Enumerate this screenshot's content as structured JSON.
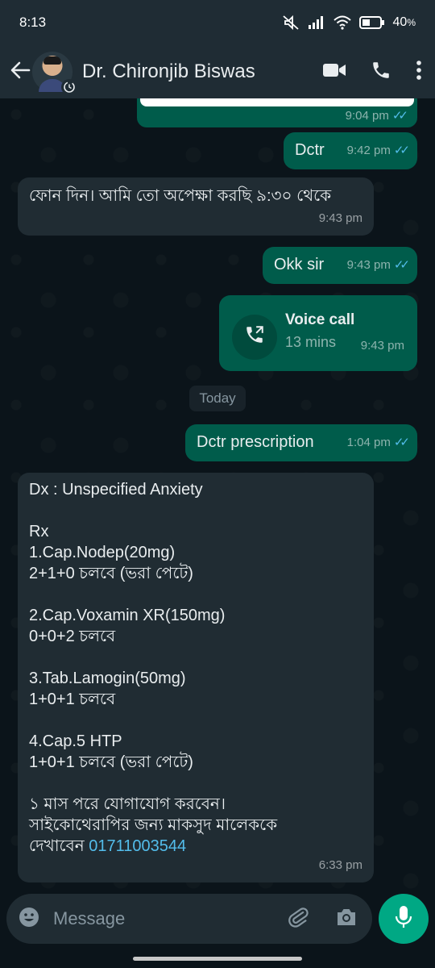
{
  "status_bar": {
    "time": "8:13",
    "battery": "40",
    "battery_suffix": "%",
    "icons": [
      "mute-icon",
      "signal-icon",
      "wifi-icon",
      "battery-icon"
    ]
  },
  "header": {
    "contact_name": "Dr. Chironjib Biswas",
    "icons": [
      "back-arrow-icon",
      "disappearing-timer-icon",
      "video-call-icon",
      "phone-icon",
      "more-vert-icon"
    ]
  },
  "colors": {
    "outgoing_bubble": "#005c4b",
    "incoming_bubble": "#202c33",
    "accent": "#00a884",
    "read_ticks": "#53bdeb",
    "background": "#0b141a"
  },
  "messages": {
    "partial_top": {
      "time": "9:04 pm",
      "ticks": "✓✓"
    },
    "m1": {
      "text": "Dctr",
      "time": "9:42 pm",
      "ticks": "✓✓"
    },
    "m2": {
      "text": "ফোন দিন। আমি তো অপেক্ষা করছি ৯:৩০ থেকে",
      "time": "9:43 pm"
    },
    "m3": {
      "text": "Okk sir",
      "time": "9:43 pm",
      "ticks": "✓✓"
    },
    "call": {
      "title": "Voice call",
      "duration": "13 mins",
      "time": "9:43 pm",
      "icon": "outgoing-call-icon"
    },
    "date_divider": "Today",
    "m4": {
      "text": "Dctr prescription",
      "time": "1:04 pm",
      "ticks": "✓✓"
    },
    "prescription": {
      "body": "Dx : Unspecified Anxiety\n\nRx\n1.Cap.Nodep(20mg)\n2+1+0 চলবে (ভরা পেটে)\n\n2.Cap.Voxamin XR(150mg)\n0+0+2 চলবে\n\n3.Tab.Lamogin(50mg)\n1+0+1 চলবে\n\n4.Cap.5 HTP\n1+0+1 চলবে (ভরা পেটে)\n\n১ মাস পরে যোগাযোগ করবেন।\nসাইকোথেরাপির জন্য মাকসুদ মালেককে\nদেখাবেন ",
      "phone": "01711003544",
      "time": "6:33 pm"
    }
  },
  "input": {
    "placeholder": "Message",
    "icons": [
      "emoji-icon",
      "attach-icon",
      "camera-icon",
      "mic-icon"
    ]
  }
}
